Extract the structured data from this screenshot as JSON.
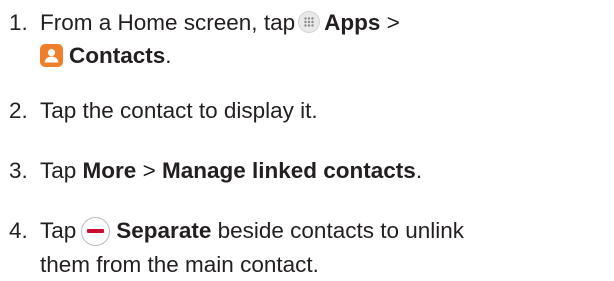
{
  "steps": [
    {
      "number": "1.",
      "line1": {
        "pre": "From a Home screen, tap",
        "apps_label": "Apps",
        "separator": ">"
      },
      "line2": {
        "contacts_label": "Contacts",
        "end": "."
      },
      "icons": [
        "apps-icon",
        "contacts-icon"
      ]
    },
    {
      "number": "2.",
      "text": "Tap the contact to display it."
    },
    {
      "number": "3.",
      "pre": "Tap",
      "more_label": "More",
      "separator": ">",
      "manage_label": "Manage linked contacts",
      "end": "."
    },
    {
      "number": "4.",
      "pre": "Tap",
      "separate_label": "Separate",
      "post": "beside contacts to unlink",
      "line2": "them from the main contact.",
      "icons": [
        "remove-icon"
      ]
    }
  ],
  "colors": {
    "text": "#231f20",
    "contacts_icon": "#f07f2c",
    "remove_bar": "#c8102e"
  }
}
